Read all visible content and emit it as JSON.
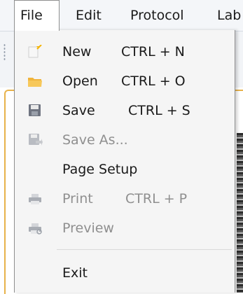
{
  "menubar": {
    "items": [
      {
        "label": "File"
      },
      {
        "label": "Edit"
      },
      {
        "label": "Protocol"
      },
      {
        "label": "Lab"
      }
    ]
  },
  "file_menu": {
    "items": [
      {
        "label": "New",
        "shortcut": "CTRL + N",
        "icon": "new-document-icon",
        "enabled": true
      },
      {
        "label": "Open",
        "shortcut": "CTRL + O",
        "icon": "folder-open-icon",
        "enabled": true
      },
      {
        "label": "Save",
        "shortcut": "CTRL + S",
        "icon": "floppy-disk-icon",
        "enabled": true
      },
      {
        "label": "Save As...",
        "shortcut": "",
        "icon": "save-as-icon",
        "enabled": false
      },
      {
        "label": "Page Setup",
        "shortcut": "",
        "icon": "",
        "enabled": true
      },
      {
        "label": "Print",
        "shortcut": "CTRL + P",
        "icon": "printer-icon",
        "enabled": false
      },
      {
        "label": "Preview",
        "shortcut": "",
        "icon": "print-preview-icon",
        "enabled": false
      },
      {
        "label": "Exit",
        "shortcut": "",
        "icon": "",
        "enabled": true
      }
    ]
  },
  "colors": {
    "accent_border": "#e7b24a",
    "disabled_text": "#8f8f8f",
    "menu_background": "#f5f5f5"
  }
}
